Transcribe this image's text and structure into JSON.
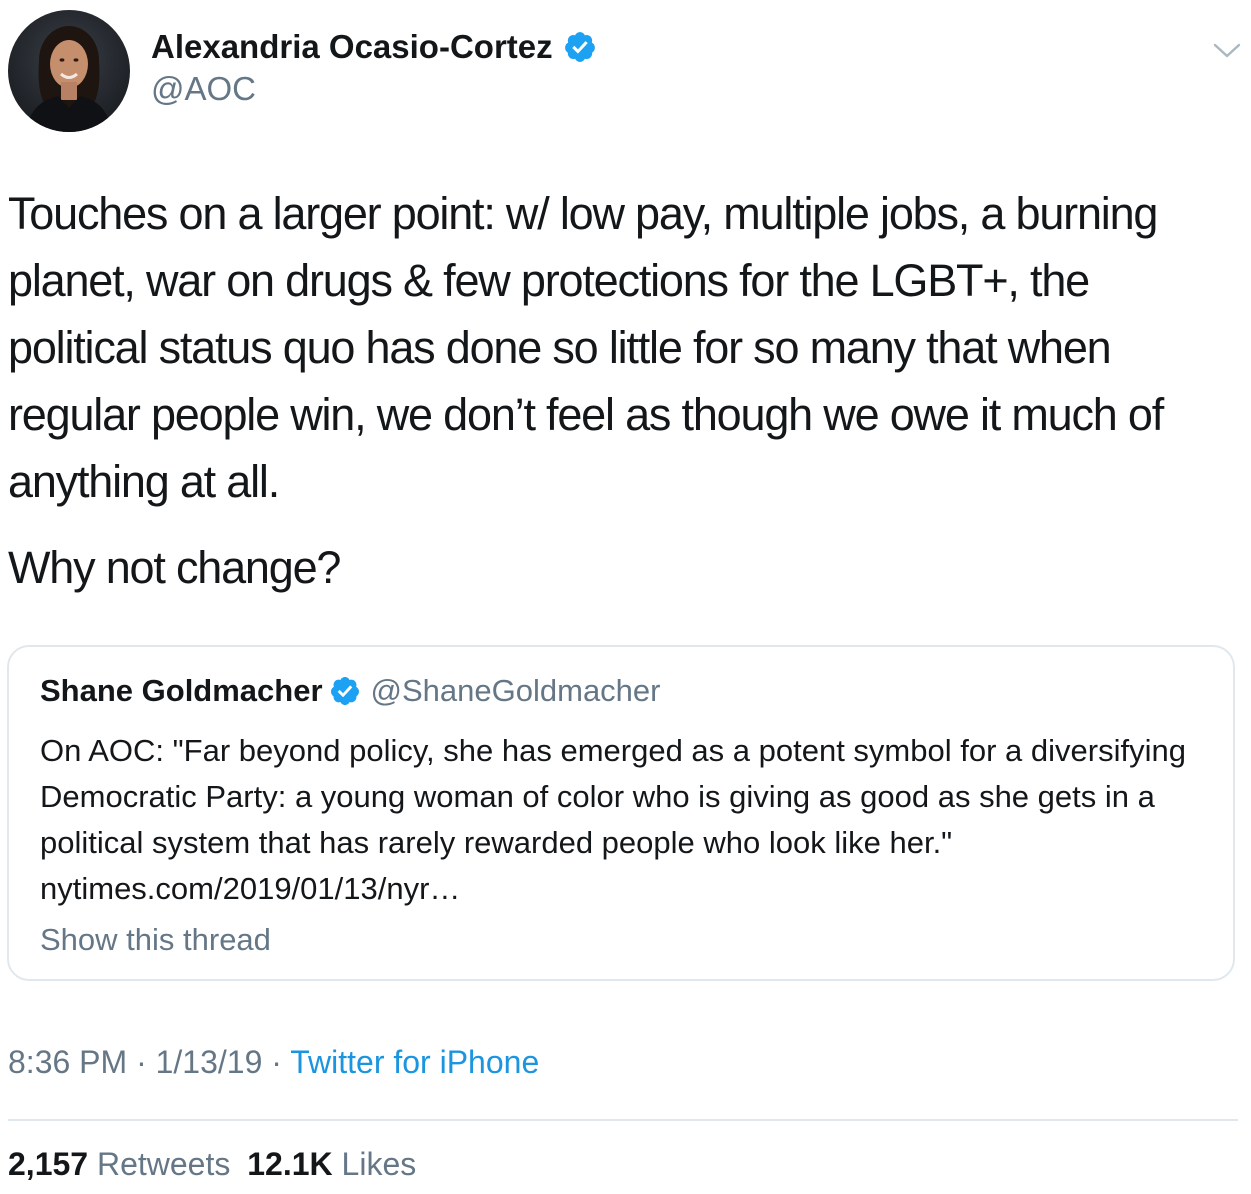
{
  "author": {
    "name": "Alexandria Ocasio-Cortez",
    "handle": "@AOC",
    "verified": true,
    "avatar_icon": "profile-photo"
  },
  "menu": {
    "icon": "chevron-down-icon"
  },
  "tweet": {
    "paragraphs": [
      "Touches on a larger point: w/ low pay, multiple jobs, a burning planet, war on drugs & few protections for the LGBT+, the political status quo has done so little for so many that when regular people win, we don’t feel as though we owe it much of anything at all.",
      "Why not change?"
    ]
  },
  "quoted_tweet": {
    "name": "Shane Goldmacher",
    "handle": "@ShaneGoldmacher",
    "verified": true,
    "text": "On AOC: \"Far beyond policy, she has emerged as a potent symbol for a diversifying Democratic Party: a young woman of color who is giving as good as she gets in a political system that has rarely rewarded people who look like her.\" nytimes.com/2019/01/13/nyr…",
    "show_thread": "Show this thread"
  },
  "meta": {
    "time": "8:36 PM",
    "separator": "·",
    "date": "1/13/19",
    "source": "Twitter for iPhone"
  },
  "stats": {
    "retweets_count": "2,157",
    "retweets_label": "Retweets",
    "likes_count": "12.1K",
    "likes_label": "Likes"
  },
  "colors": {
    "text": "#14171a",
    "secondary": "#657786",
    "link": "#1b95e0",
    "verified": "#1da1f2",
    "border": "#e1e8ed"
  }
}
